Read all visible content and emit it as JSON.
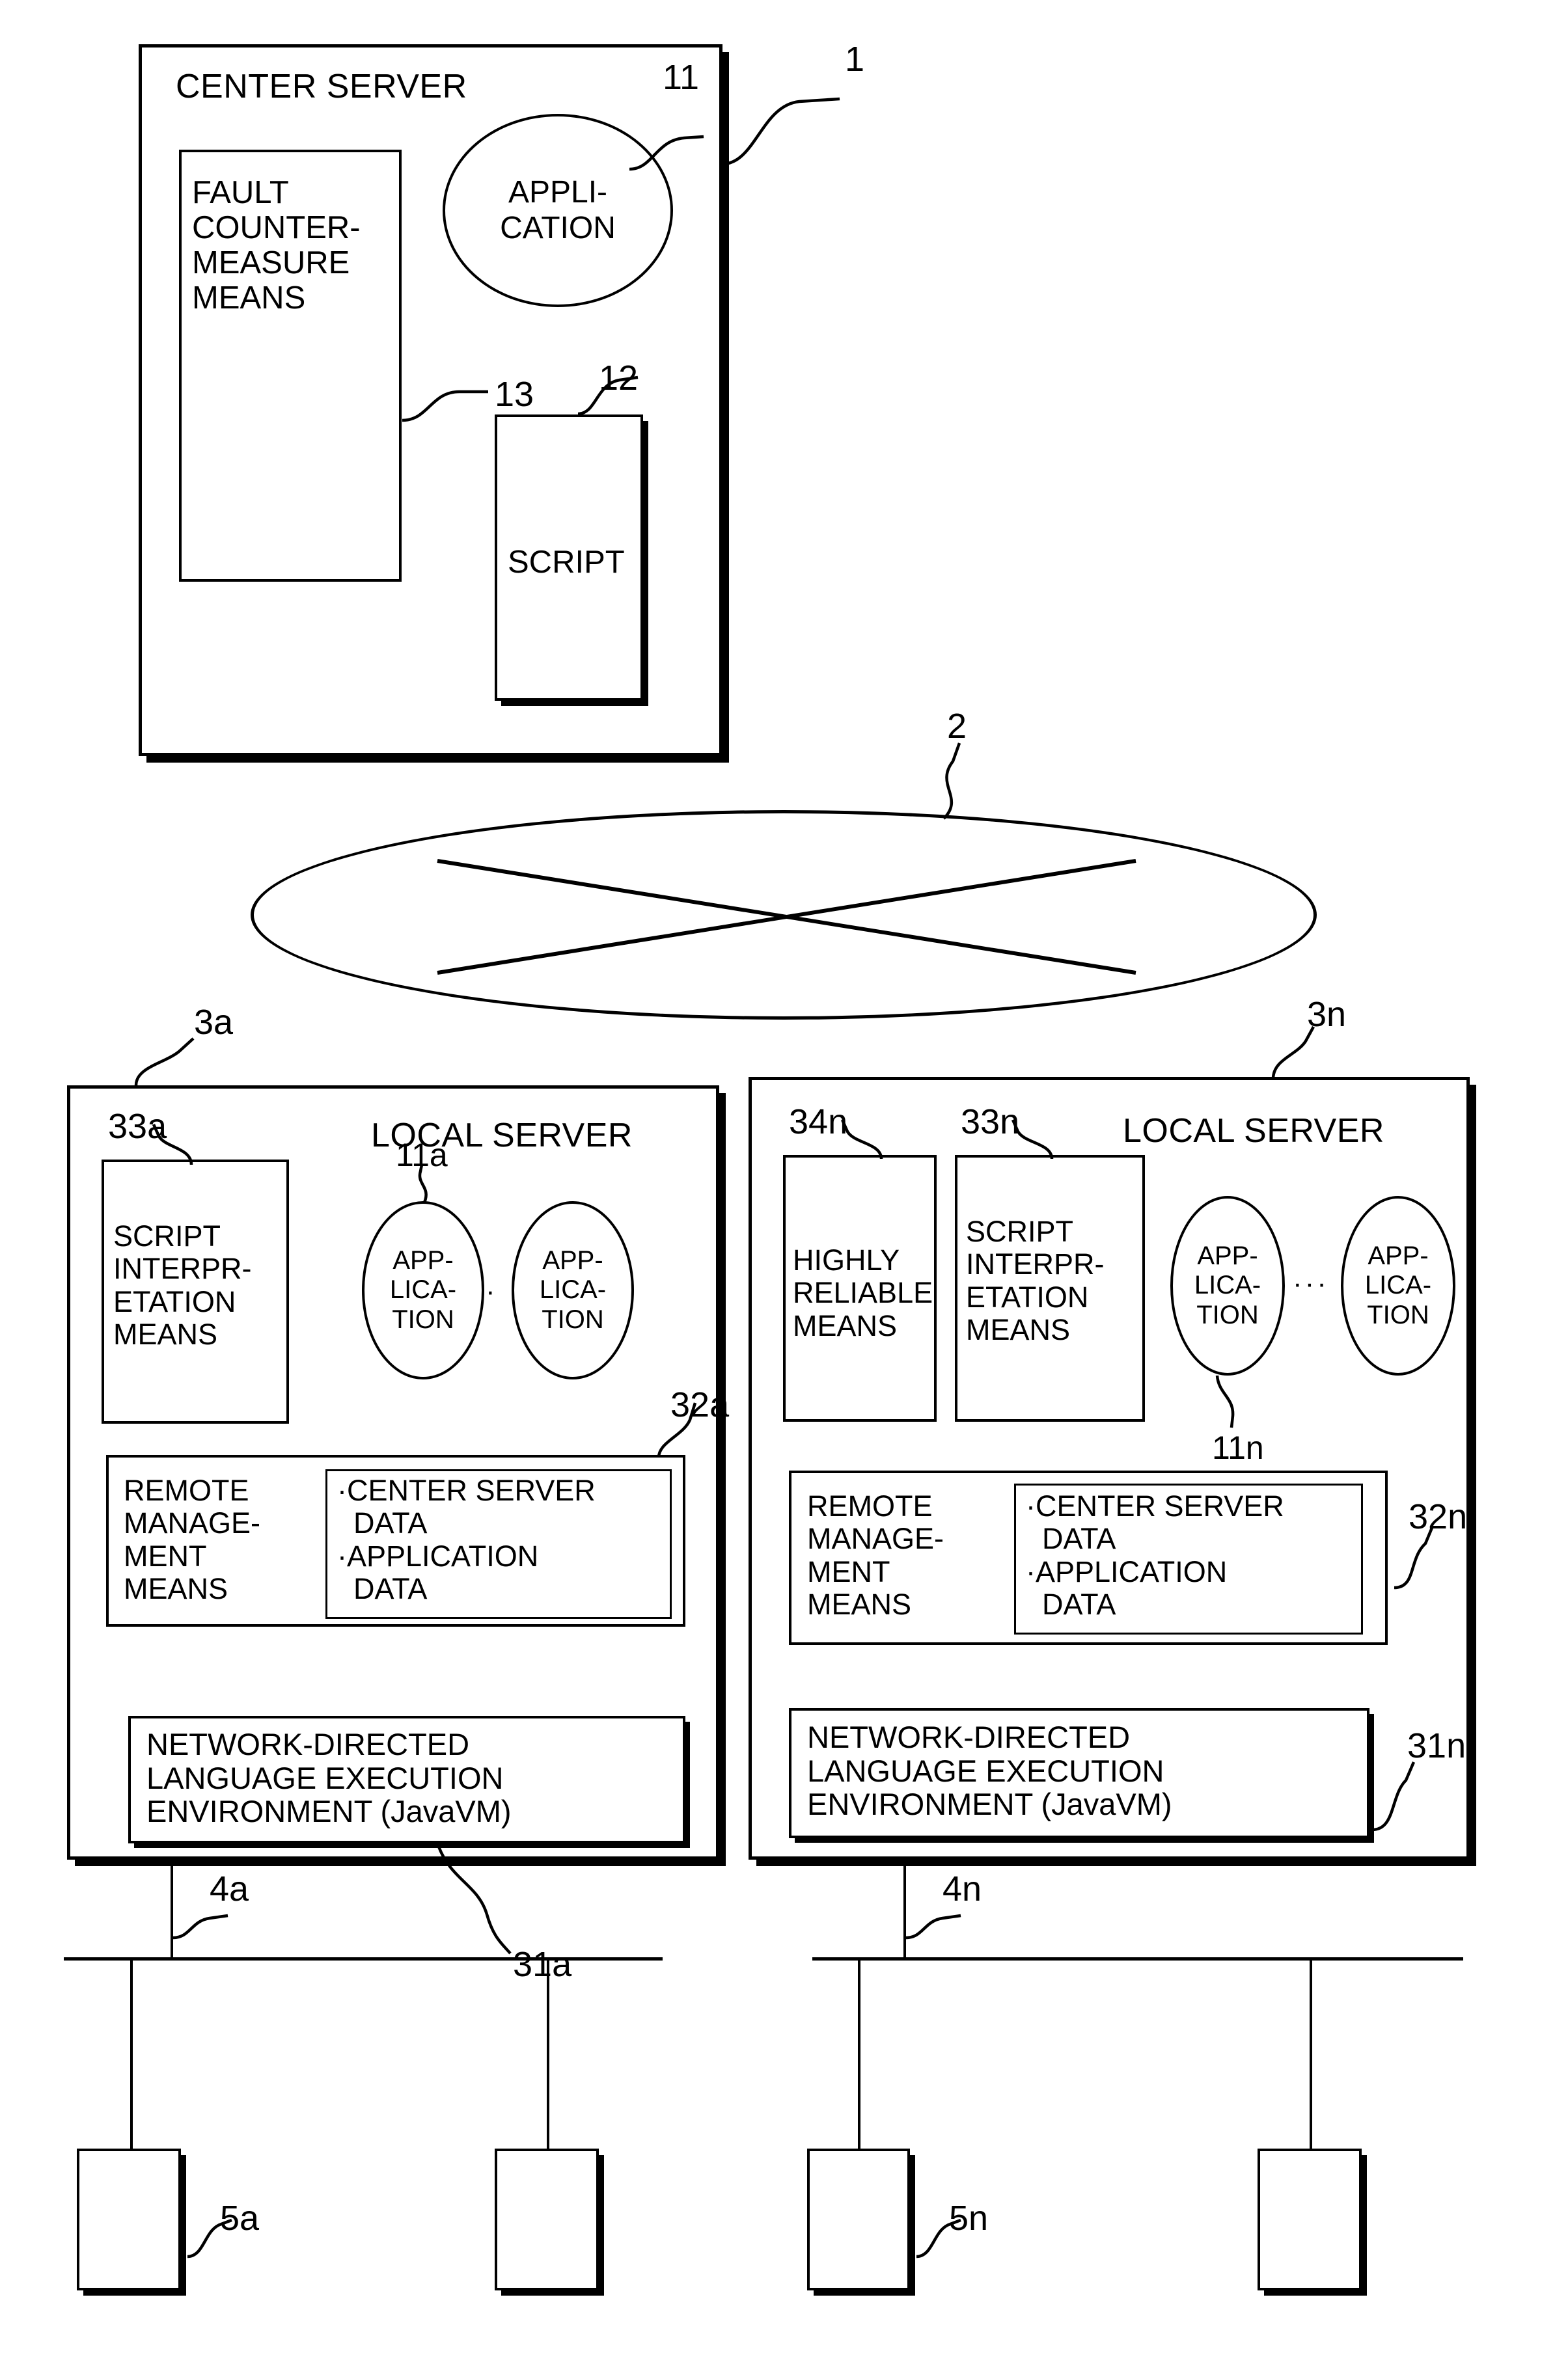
{
  "figure": {
    "kind": "patent-block-diagram",
    "center_server": {
      "ref": "1",
      "title": "CENTER SERVER",
      "fault_means": {
        "ref": "13",
        "lines": "FAULT\nCOUNTER-\nMEASURE\nMEANS"
      },
      "application": {
        "ref": "11",
        "lines": "APPLI-\nCATION"
      },
      "script": {
        "ref": "12",
        "label": "SCRIPT"
      }
    },
    "network": {
      "ref": "2"
    },
    "local_server_a": {
      "ref": "3a",
      "title": "LOCAL SERVER",
      "script_interp": {
        "ref": "33a",
        "lines": "SCRIPT\nINTERPR-\nETATION\nMEANS"
      },
      "applications": {
        "ref": "11a",
        "separator": "·",
        "items": [
          {
            "lines": "APP-\nLICA-\nTION"
          },
          {
            "lines": "APP-\nLICA-\nTION"
          }
        ]
      },
      "remote_mgmt": {
        "ref": "32a",
        "lines": "REMOTE\nMANAGE-\nMENT\nMEANS",
        "data_items": "·CENTER SERVER\n  DATA\n·APPLICATION\n  DATA"
      },
      "runtime": {
        "ref": "31a",
        "lines": "NETWORK-DIRECTED\nLANGUAGE EXECUTION\nENVIRONMENT (JavaVM)"
      },
      "bus": {
        "ref": "4a"
      },
      "terminal": {
        "ref": "5a"
      }
    },
    "local_server_n": {
      "ref": "3n",
      "title": "LOCAL SERVER",
      "highly_reliable": {
        "ref": "34n",
        "lines": "HIGHLY\nRELIABLE\nMEANS"
      },
      "script_interp": {
        "ref": "33n",
        "lines": "SCRIPT\nINTERPR-\nETATION\nMEANS"
      },
      "applications": {
        "ref": "11n",
        "separator": "···",
        "items": [
          {
            "lines": "APP-\nLICA-\nTION"
          },
          {
            "lines": "APP-\nLICA-\nTION"
          }
        ]
      },
      "remote_mgmt": {
        "ref": "32n",
        "lines": "REMOTE\nMANAGE-\nMENT\nMEANS",
        "data_items": "·CENTER SERVER\n  DATA\n·APPLICATION\n  DATA"
      },
      "runtime": {
        "ref": "31n",
        "lines": "NETWORK-DIRECTED\nLANGUAGE EXECUTION\nENVIRONMENT (JavaVM)"
      },
      "bus": {
        "ref": "4n"
      },
      "terminal": {
        "ref": "5n"
      }
    },
    "colors": {
      "ink": "#000000",
      "paper": "#ffffff"
    }
  }
}
